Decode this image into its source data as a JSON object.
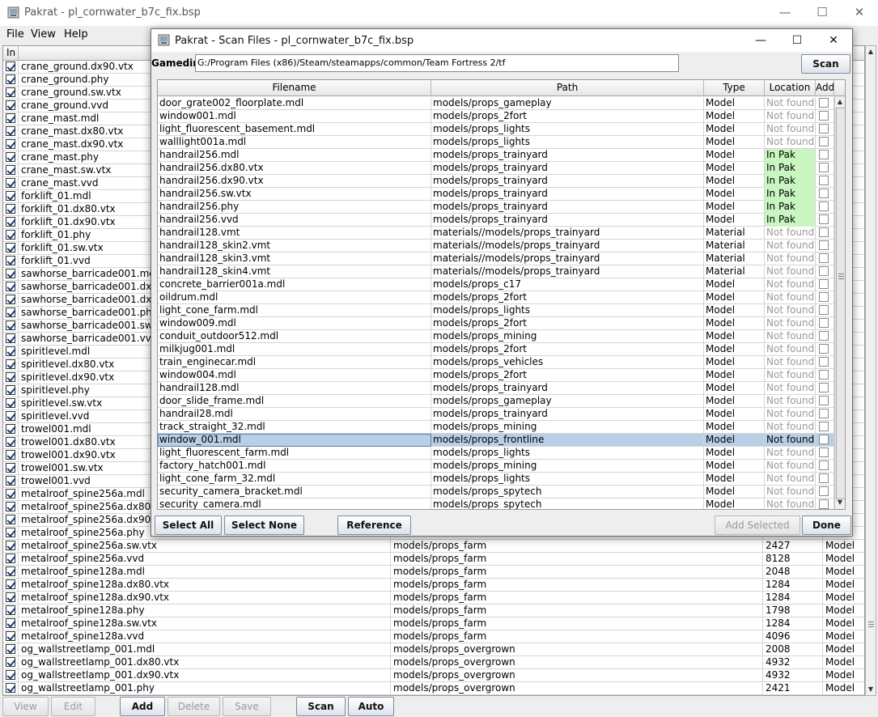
{
  "main_window": {
    "title": "Pakrat - pl_cornwater_b7c_fix.bsp",
    "controls": {
      "minimize": "—",
      "maximize": "☐",
      "close": "✕"
    },
    "menu": [
      "File",
      "View",
      "Help"
    ],
    "table": {
      "header_first": "In",
      "rows": [
        {
          "name": "crane_ground.dx90.vtx"
        },
        {
          "name": "crane_ground.phy"
        },
        {
          "name": "crane_ground.sw.vtx"
        },
        {
          "name": "crane_ground.vvd"
        },
        {
          "name": "crane_mast.mdl"
        },
        {
          "name": "crane_mast.dx80.vtx"
        },
        {
          "name": "crane_mast.dx90.vtx"
        },
        {
          "name": "crane_mast.phy"
        },
        {
          "name": "crane_mast.sw.vtx"
        },
        {
          "name": "crane_mast.vvd"
        },
        {
          "name": "forklift_01.mdl"
        },
        {
          "name": "forklift_01.dx80.vtx"
        },
        {
          "name": "forklift_01.dx90.vtx"
        },
        {
          "name": "forklift_01.phy"
        },
        {
          "name": "forklift_01.sw.vtx"
        },
        {
          "name": "forklift_01.vvd"
        },
        {
          "name": "sawhorse_barricade001.mdl"
        },
        {
          "name": "sawhorse_barricade001.dx80.vtx"
        },
        {
          "name": "sawhorse_barricade001.dx90.vtx"
        },
        {
          "name": "sawhorse_barricade001.phy"
        },
        {
          "name": "sawhorse_barricade001.sw.vtx"
        },
        {
          "name": "sawhorse_barricade001.vvd"
        },
        {
          "name": "spiritlevel.mdl"
        },
        {
          "name": "spiritlevel.dx80.vtx"
        },
        {
          "name": "spiritlevel.dx90.vtx"
        },
        {
          "name": "spiritlevel.phy"
        },
        {
          "name": "spiritlevel.sw.vtx"
        },
        {
          "name": "spiritlevel.vvd"
        },
        {
          "name": "trowel001.mdl"
        },
        {
          "name": "trowel001.dx80.vtx"
        },
        {
          "name": "trowel001.dx90.vtx"
        },
        {
          "name": "trowel001.sw.vtx"
        },
        {
          "name": "trowel001.vvd"
        },
        {
          "name": "metalroof_spine256a.mdl"
        },
        {
          "name": "metalroof_spine256a.dx80.vtx"
        },
        {
          "name": "metalroof_spine256a.dx90.vtx"
        },
        {
          "name": "metalroof_spine256a.phy"
        },
        {
          "name": "metalroof_spine256a.sw.vtx",
          "path": "models/props_farm",
          "size": "2427",
          "type": "Model"
        },
        {
          "name": "metalroof_spine256a.vvd",
          "path": "models/props_farm",
          "size": "8128",
          "type": "Model"
        },
        {
          "name": "metalroof_spine128a.mdl",
          "path": "models/props_farm",
          "size": "2048",
          "type": "Model"
        },
        {
          "name": "metalroof_spine128a.dx80.vtx",
          "path": "models/props_farm",
          "size": "1284",
          "type": "Model"
        },
        {
          "name": "metalroof_spine128a.dx90.vtx",
          "path": "models/props_farm",
          "size": "1284",
          "type": "Model"
        },
        {
          "name": "metalroof_spine128a.phy",
          "path": "models/props_farm",
          "size": "1798",
          "type": "Model"
        },
        {
          "name": "metalroof_spine128a.sw.vtx",
          "path": "models/props_farm",
          "size": "1284",
          "type": "Model"
        },
        {
          "name": "metalroof_spine128a.vvd",
          "path": "models/props_farm",
          "size": "4096",
          "type": "Model"
        },
        {
          "name": "og_wallstreetlamp_001.mdl",
          "path": "models/props_overgrown",
          "size": "2008",
          "type": "Model"
        },
        {
          "name": "og_wallstreetlamp_001.dx80.vtx",
          "path": "models/props_overgrown",
          "size": "4932",
          "type": "Model"
        },
        {
          "name": "og_wallstreetlamp_001.dx90.vtx",
          "path": "models/props_overgrown",
          "size": "4932",
          "type": "Model"
        },
        {
          "name": "og_wallstreetlamp_001.phy",
          "path": "models/props_overgrown",
          "size": "2421",
          "type": "Model"
        }
      ]
    },
    "buttons": {
      "view": "View",
      "edit": "Edit",
      "add": "Add",
      "delete": "Delete",
      "save": "Save",
      "scan": "Scan",
      "auto": "Auto"
    }
  },
  "dialog": {
    "title": "Pakrat - Scan Files - pl_cornwater_b7c_fix.bsp",
    "controls": {
      "minimize": "—",
      "maximize": "☐",
      "close": "✕"
    },
    "gamedir_label": "Gamedir:",
    "gamedir_value": "G:/Program Files (x86)/Steam/steamapps/common/Team Fortress 2/tf",
    "scan_button": "Scan",
    "columns": {
      "filename": "Filename",
      "path": "Path",
      "type": "Type",
      "location": "Location",
      "add": "Add"
    },
    "rows": [
      {
        "filename": "door_grate002_floorplate.mdl",
        "path": "models/props_gameplay",
        "type": "Model",
        "location": "Not found"
      },
      {
        "filename": "window001.mdl",
        "path": "models/props_2fort",
        "type": "Model",
        "location": "Not found"
      },
      {
        "filename": "light_fluorescent_basement.mdl",
        "path": "models/props_lights",
        "type": "Model",
        "location": "Not found"
      },
      {
        "filename": "walllight001a.mdl",
        "path": "models/props_lights",
        "type": "Model",
        "location": "Not found"
      },
      {
        "filename": "handrail256.mdl",
        "path": "models/props_trainyard",
        "type": "Model",
        "location": "In Pak"
      },
      {
        "filename": "handrail256.dx80.vtx",
        "path": "models/props_trainyard",
        "type": "Model",
        "location": "In Pak"
      },
      {
        "filename": "handrail256.dx90.vtx",
        "path": "models/props_trainyard",
        "type": "Model",
        "location": "In Pak"
      },
      {
        "filename": "handrail256.sw.vtx",
        "path": "models/props_trainyard",
        "type": "Model",
        "location": "In Pak"
      },
      {
        "filename": "handrail256.phy",
        "path": "models/props_trainyard",
        "type": "Model",
        "location": "In Pak"
      },
      {
        "filename": "handrail256.vvd",
        "path": "models/props_trainyard",
        "type": "Model",
        "location": "In Pak"
      },
      {
        "filename": "handrail128.vmt",
        "path": "materials//models/props_trainyard",
        "type": "Material",
        "location": "Not found"
      },
      {
        "filename": "handrail128_skin2.vmt",
        "path": "materials//models/props_trainyard",
        "type": "Material",
        "location": "Not found"
      },
      {
        "filename": "handrail128_skin3.vmt",
        "path": "materials//models/props_trainyard",
        "type": "Material",
        "location": "Not found"
      },
      {
        "filename": "handrail128_skin4.vmt",
        "path": "materials//models/props_trainyard",
        "type": "Material",
        "location": "Not found"
      },
      {
        "filename": "concrete_barrier001a.mdl",
        "path": "models/props_c17",
        "type": "Model",
        "location": "Not found"
      },
      {
        "filename": "oildrum.mdl",
        "path": "models/props_2fort",
        "type": "Model",
        "location": "Not found"
      },
      {
        "filename": "light_cone_farm.mdl",
        "path": "models/props_lights",
        "type": "Model",
        "location": "Not found"
      },
      {
        "filename": "window009.mdl",
        "path": "models/props_2fort",
        "type": "Model",
        "location": "Not found"
      },
      {
        "filename": "conduit_outdoor512.mdl",
        "path": "models/props_mining",
        "type": "Model",
        "location": "Not found"
      },
      {
        "filename": "milkjug001.mdl",
        "path": "models/props_2fort",
        "type": "Model",
        "location": "Not found"
      },
      {
        "filename": "train_enginecar.mdl",
        "path": "models/props_vehicles",
        "type": "Model",
        "location": "Not found"
      },
      {
        "filename": "window004.mdl",
        "path": "models/props_2fort",
        "type": "Model",
        "location": "Not found"
      },
      {
        "filename": "handrail128.mdl",
        "path": "models/props_trainyard",
        "type": "Model",
        "location": "Not found"
      },
      {
        "filename": "door_slide_frame.mdl",
        "path": "models/props_gameplay",
        "type": "Model",
        "location": "Not found"
      },
      {
        "filename": "handrail28.mdl",
        "path": "models/props_trainyard",
        "type": "Model",
        "location": "Not found"
      },
      {
        "filename": "track_straight_32.mdl",
        "path": "models/props_mining",
        "type": "Model",
        "location": "Not found"
      },
      {
        "filename": "window_001.mdl",
        "path": "models/props_frontline",
        "type": "Model",
        "location": "Not found",
        "selected": true
      },
      {
        "filename": "light_fluorescent_farm.mdl",
        "path": "models/props_lights",
        "type": "Model",
        "location": "Not found"
      },
      {
        "filename": "factory_hatch001.mdl",
        "path": "models/props_mining",
        "type": "Model",
        "location": "Not found"
      },
      {
        "filename": "light_cone_farm_32.mdl",
        "path": "models/props_lights",
        "type": "Model",
        "location": "Not found"
      },
      {
        "filename": "security_camera_bracket.mdl",
        "path": "models/props_spytech",
        "type": "Model",
        "location": "Not found"
      },
      {
        "filename": "security_camera.mdl",
        "path": "models/props_spytech",
        "type": "Model",
        "location": "Not found"
      }
    ],
    "buttons": {
      "select_all": "Select All",
      "select_none": "Select None",
      "reference": "Reference",
      "add_selected": "Add Selected",
      "done": "Done"
    }
  }
}
